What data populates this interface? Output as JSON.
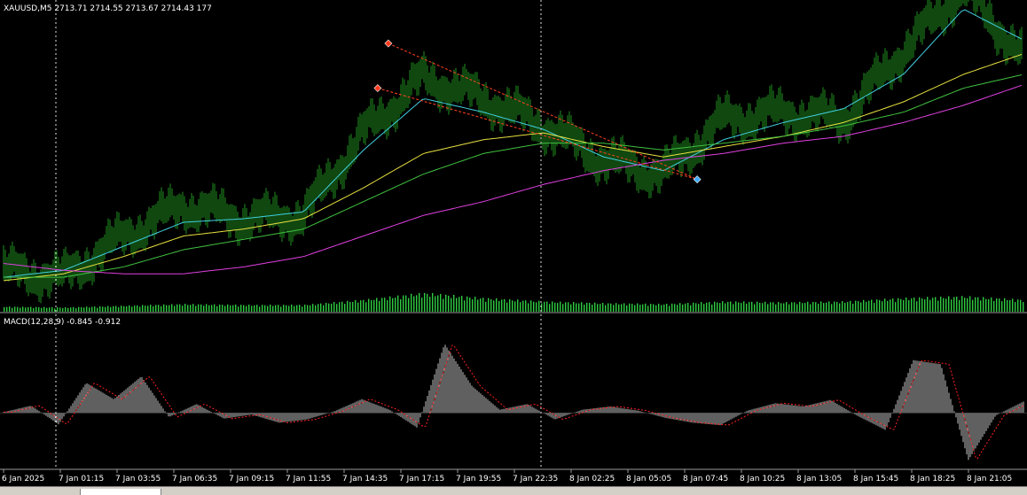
{
  "chart_data": [
    {
      "type": "line",
      "panel": "main",
      "header": "XAUUSD,M5  2713.71 2714.55 2713.67 2714.43  177",
      "x": [
        "6 Jan 2025",
        "7 Jan 01:15",
        "7 Jan 03:55",
        "7 Jan 06:35",
        "7 Jan 09:15",
        "7 Jan 11:55",
        "7 Jan 14:35",
        "7 Jan 17:15",
        "7 Jan 19:55",
        "7 Jan 22:35",
        "8 Jan 02:25",
        "8 Jan 05:05",
        "8 Jan 07:45",
        "8 Jan 10:25",
        "8 Jan 13:05",
        "8 Jan 15:45",
        "8 Jan 18:25",
        "8 Jan 21:05"
      ],
      "ylim": [
        2625,
        2710
      ],
      "series": [
        {
          "role": "price",
          "values": [
            2636,
            2634,
            2646,
            2655,
            2651,
            2652,
            2676,
            2692,
            2686,
            2678,
            2668,
            2664,
            2680,
            2682,
            2680,
            2700,
            2718,
            2698
          ]
        },
        {
          "role": "ma-fast",
          "values": [
            2634,
            2636,
            2643,
            2650,
            2651,
            2653,
            2671,
            2686,
            2682,
            2677,
            2669,
            2665,
            2674,
            2679,
            2683,
            2693,
            2712,
            2703
          ]
        },
        {
          "role": "ma-mid",
          "values": [
            2633,
            2635,
            2640,
            2646,
            2648,
            2651,
            2660,
            2670,
            2674,
            2676,
            2672,
            2669,
            2672,
            2675,
            2679,
            2685,
            2693,
            2699
          ]
        },
        {
          "role": "ma-slow",
          "values": [
            2634,
            2634,
            2637,
            2642,
            2645,
            2648,
            2656,
            2664,
            2670,
            2673,
            2673,
            2671,
            2673,
            2675,
            2678,
            2682,
            2689,
            2693
          ]
        },
        {
          "role": "ma-long",
          "values": [
            2638,
            2636,
            2635,
            2635,
            2637,
            2640,
            2646,
            2652,
            2656,
            2661,
            2665,
            2668,
            2670,
            2673,
            2675,
            2679,
            2684,
            2690
          ]
        }
      ],
      "markers": [
        {
          "x": "7 Jan 14:35",
          "y": 2702,
          "color": "#ff3b1f"
        },
        {
          "x": "7 Jan 14:35",
          "y": 2689,
          "color": "#ff3b1f"
        },
        {
          "x": "8 Jan 05:05",
          "y": 2664,
          "color": "#3fa9ff"
        }
      ],
      "volume": [
        6,
        5,
        7,
        9,
        8,
        8,
        14,
        22,
        16,
        12,
        10,
        9,
        12,
        11,
        12,
        16,
        18,
        14
      ]
    },
    {
      "type": "bar",
      "panel": "indicator",
      "header": "MACD(12,28,9) -0.845 -0.912",
      "ylim": [
        -6.5,
        10.5
      ],
      "macd": [
        0.1,
        0.9,
        -1.4,
        3.7,
        1.7,
        4.5,
        -0.5,
        1.1,
        -0.7,
        -0.2,
        -1.2,
        -0.8,
        0.2,
        1.7,
        0.4,
        -1.8,
        8.5,
        3.3,
        0.4,
        1.1,
        -0.8,
        0.4,
        0.8,
        0.3,
        -0.6,
        -1.2,
        -1.5,
        0.3,
        1.2,
        0.8,
        1.6,
        -0.4,
        -2.1,
        6.5,
        6.0,
        -5.8,
        -0.3,
        1.4
      ],
      "signal_color": "#ff2020"
    }
  ],
  "colors": {
    "background": "#000000",
    "candles": "#1f8f1f",
    "volume": "#2ecc40",
    "ma_fast": "#40d0e0",
    "ma_mid": "#e8e040",
    "ma_slow": "#40c040",
    "ma_long": "#e040e0",
    "macd_bar": "#c0c0c0",
    "signal": "#ff2020",
    "grid": "#d0d0d0",
    "trend": "#ff4020"
  }
}
